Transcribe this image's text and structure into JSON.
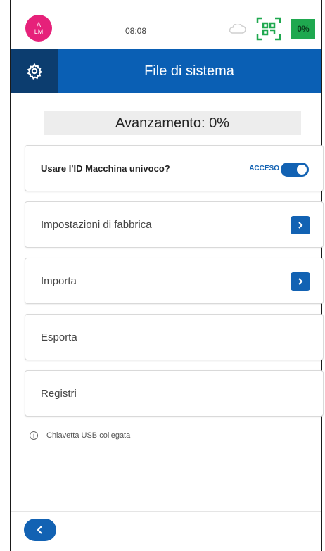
{
  "status_bar": {
    "avatar_lines": [
      "A",
      "LM"
    ],
    "clock": "08:08",
    "battery": "0%",
    "icons": [
      "cloud-icon",
      "qr-code-icon"
    ]
  },
  "header": {
    "title": "File di sistema",
    "settings_icon": "gear-icon"
  },
  "progress": {
    "label": "Avanzamento: 0%"
  },
  "options": {
    "unique_id": {
      "label": "Usare l'ID Macchina univoco?",
      "state": "ACCESO",
      "enabled": true
    },
    "factory": {
      "label": "Impostazioni di fabbrica",
      "icon": "chevron-right-icon"
    },
    "import": {
      "label": "Importa",
      "icon": "chevron-right-icon"
    },
    "export": {
      "label": "Esporta"
    },
    "logs": {
      "label": "Registri"
    }
  },
  "info": {
    "text": "Chiavetta USB collegata",
    "icon": "info-icon"
  },
  "footer": {
    "back_icon": "chevron-left-icon"
  },
  "colors": {
    "primary": "#0a5fb4",
    "header_dark": "#0c3d6f",
    "avatar": "#e6217a",
    "battery": "#1fa84f",
    "qr": "#1fa84f"
  }
}
